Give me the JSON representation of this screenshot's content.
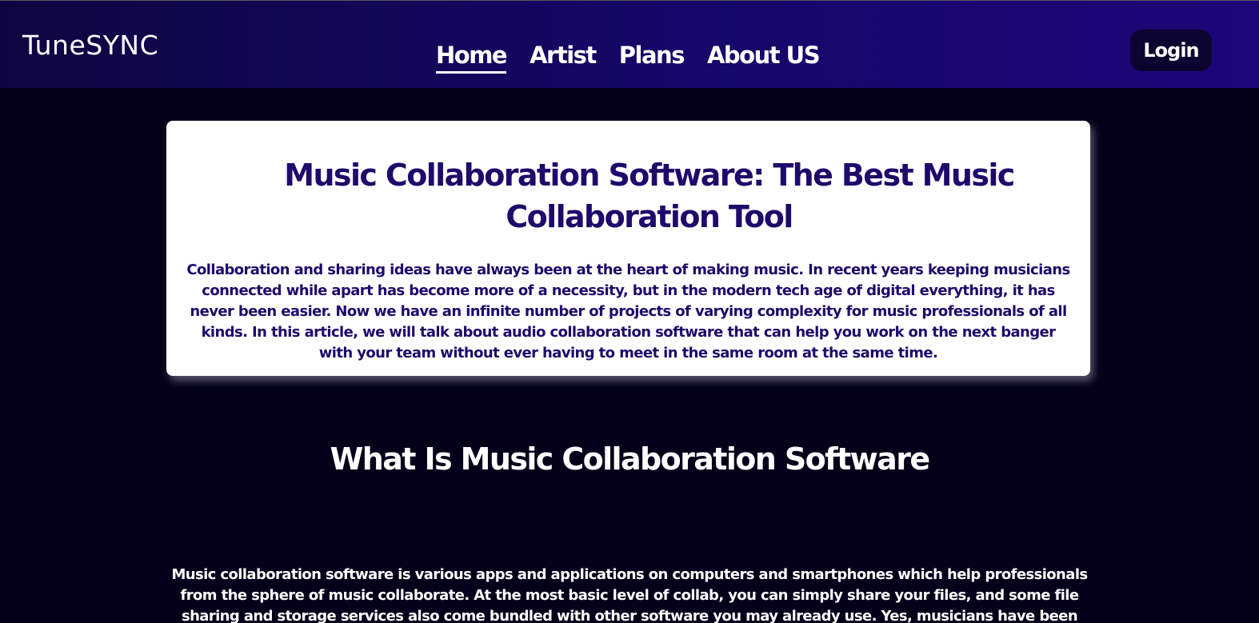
{
  "header": {
    "logo": "TuneSYNC",
    "nav": [
      {
        "label": "Home",
        "active": true
      },
      {
        "label": "Artist",
        "active": false
      },
      {
        "label": "Plans",
        "active": false
      },
      {
        "label": "About US",
        "active": false
      }
    ],
    "login_label": "Login"
  },
  "intro": {
    "title": "Music Collaboration Software: The Best Music Collaboration Tool",
    "text": "Collaboration and sharing ideas have always been at the heart of making music. In recent years keeping musicians connected while apart has become more of a necessity, but in the modern tech age of digital everything, it has never been easier. Now we have an infinite number of projects of varying complexity for music professionals of all kinds. In this article, we will talk about audio collaboration software that can help you work on the next banger with your team without ever having to meet in the same room at the same time."
  },
  "section": {
    "title": "What Is Music Collaboration Software",
    "text": "Music collaboration software is various apps and applications on computers and smartphones which help professionals from the sphere of music collaborate. At the most basic level of collab, you can simply share your files, and some file sharing and storage services also come bundled with other software you may already use. Yes, musicians have been sharing files online all the time."
  },
  "colors": {
    "background": "#04001a",
    "header_gradient_start": "#0e0540",
    "header_gradient_end": "#1c0678",
    "accent_text": "#1e0a6b",
    "card_background": "#ffffff"
  }
}
